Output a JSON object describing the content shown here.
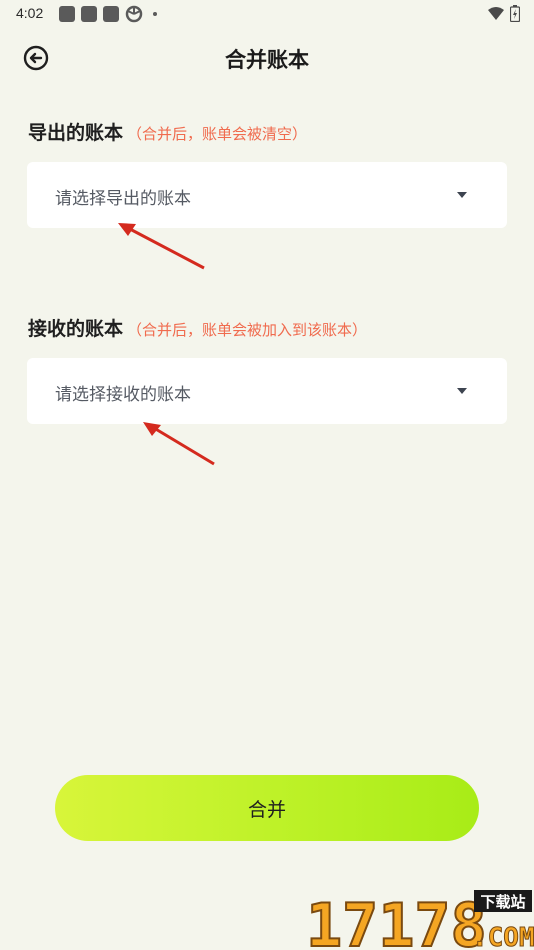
{
  "status_bar": {
    "time": "4:02"
  },
  "header": {
    "title": "合并账本"
  },
  "export_section": {
    "label": "导出的账本",
    "hint": "（合并后，账单会被清空）",
    "select_placeholder": "请选择导出的账本"
  },
  "receive_section": {
    "label": "接收的账本",
    "hint": "（合并后，账单会被加入到该账本）",
    "select_placeholder": "请选择接收的账本"
  },
  "merge_button": {
    "label": "合并"
  },
  "watermark": {
    "number": "17178",
    "site_cn": "下载站",
    "domain": ".COM"
  },
  "colors": {
    "background": "#f4f5ec",
    "hint": "#f06b4e",
    "button_start": "#d8f53a",
    "button_end": "#a8ec17",
    "annotation_arrow": "#d42a1e"
  },
  "icons": {
    "back": "back-arrow-circle-icon",
    "caret": "caret-down-icon",
    "wifi": "wifi-icon",
    "battery": "battery-icon"
  }
}
